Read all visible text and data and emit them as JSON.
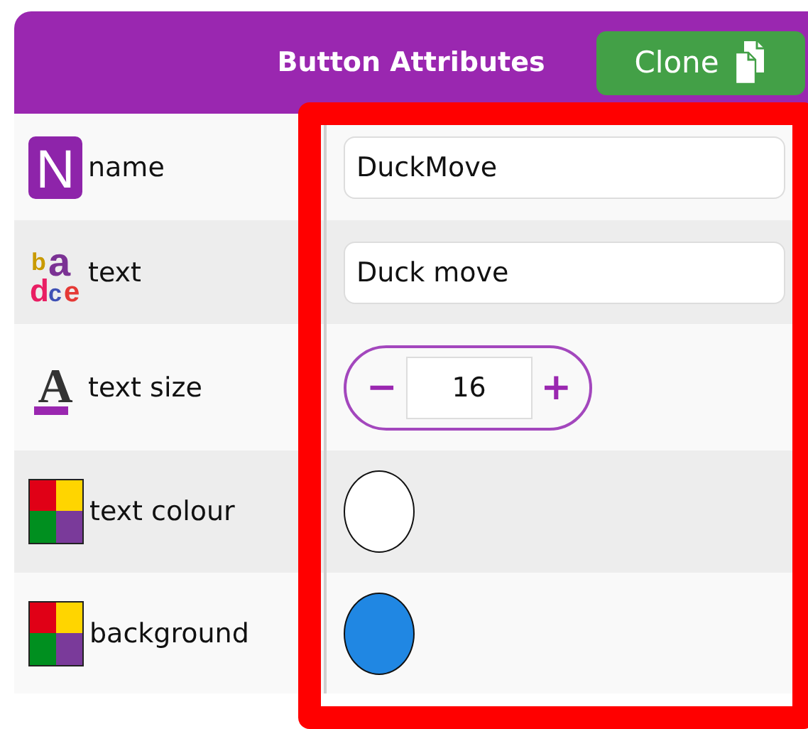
{
  "header": {
    "title": "Button Attributes",
    "clone_button": "Clone"
  },
  "rows": [
    {
      "label": "name",
      "icon": {
        "kind": "tile",
        "glyphs": [
          "N"
        ]
      },
      "kind": "text",
      "value": "DuckMove"
    },
    {
      "label": "text",
      "icon": {
        "kind": "letters",
        "glyphs": [
          "b",
          "a",
          "d",
          "c",
          "e"
        ]
      },
      "kind": "text",
      "value": "Duck move"
    },
    {
      "label": "text size",
      "icon": {
        "kind": "underline",
        "glyphs": [
          "A"
        ]
      },
      "kind": "stepper",
      "value": "16",
      "minus": "−",
      "plus": "+"
    },
    {
      "label": "text colour",
      "icon": {
        "kind": "palette"
      },
      "kind": "color",
      "color": "#ffffff"
    },
    {
      "label": "background",
      "icon": {
        "kind": "palette"
      },
      "kind": "color",
      "color": "#2087e3"
    }
  ],
  "highlight_visible": true
}
